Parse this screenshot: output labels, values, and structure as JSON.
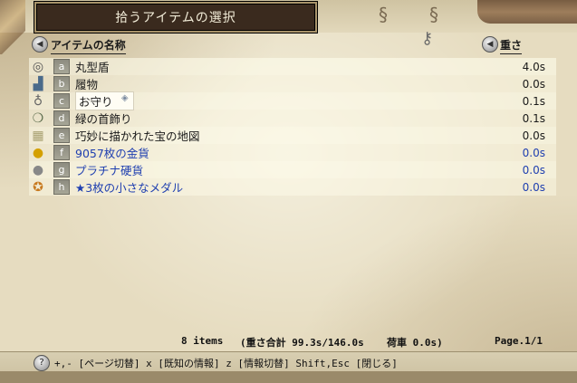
{
  "window": {
    "title": "拾うアイテムの選択"
  },
  "header": {
    "name_label": "アイテムの名称",
    "weight_label": "重さ"
  },
  "items": [
    {
      "icon": "shield-icon",
      "letter": "a",
      "name": "丸型盾",
      "weight": "4.0s",
      "color": "black"
    },
    {
      "icon": "boots-icon",
      "letter": "b",
      "name": "履物",
      "weight": "0.0s",
      "color": "black"
    },
    {
      "icon": "amulet-icon",
      "letter": "c",
      "name": "お守り",
      "weight": "0.1s",
      "color": "black",
      "selected": true
    },
    {
      "icon": "necklace-icon",
      "letter": "d",
      "name": "緑の首飾り",
      "weight": "0.1s",
      "color": "black"
    },
    {
      "icon": "map-icon",
      "letter": "e",
      "name": "巧妙に描かれた宝の地図",
      "weight": "0.0s",
      "color": "black"
    },
    {
      "icon": "gold-coin-icon",
      "letter": "f",
      "name": "9057枚の金貨",
      "weight": "0.0s",
      "color": "blue"
    },
    {
      "icon": "platinum-coin-icon",
      "letter": "g",
      "name": "プラチナ硬貨",
      "weight": "0.0s",
      "color": "blue"
    },
    {
      "icon": "medal-icon",
      "letter": "h",
      "name": "★3枚の小さなメダル",
      "weight": "0.0s",
      "color": "blue"
    }
  ],
  "summary": {
    "items_count": "8 items",
    "weight_total": "(重さ合計 99.3s/146.0s",
    "cart": "荷車 0.0s)",
    "page": "Page.1/1"
  },
  "help": {
    "text": "+,- [ページ切替]  x [既知の情報]  z [情報切替]  Shift,Esc [閉じる]"
  },
  "colors": {
    "title_bg": "#3a2a1e",
    "blue_text": "#1f3fb0",
    "letter_bg": "#9a998c"
  }
}
